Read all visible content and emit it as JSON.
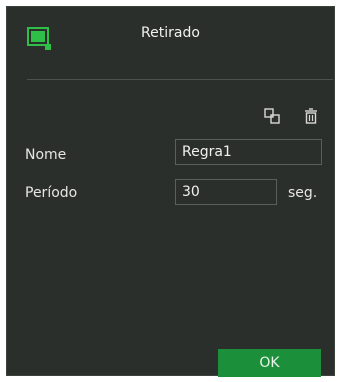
{
  "dialog": {
    "title": "Retirado",
    "app_icon": "monitor-icon"
  },
  "toolbar": {
    "copy_icon": "copy-icon",
    "delete_icon": "trash-icon"
  },
  "form": {
    "name_label": "Nome",
    "name_value": "Regra1",
    "period_label": "Período",
    "period_value": "30",
    "period_unit": "seg."
  },
  "footer": {
    "ok_label": "OK"
  },
  "colors": {
    "background": "#2b2f2b",
    "accent": "#1c8f3a",
    "icon_green": "#2fbf48"
  }
}
